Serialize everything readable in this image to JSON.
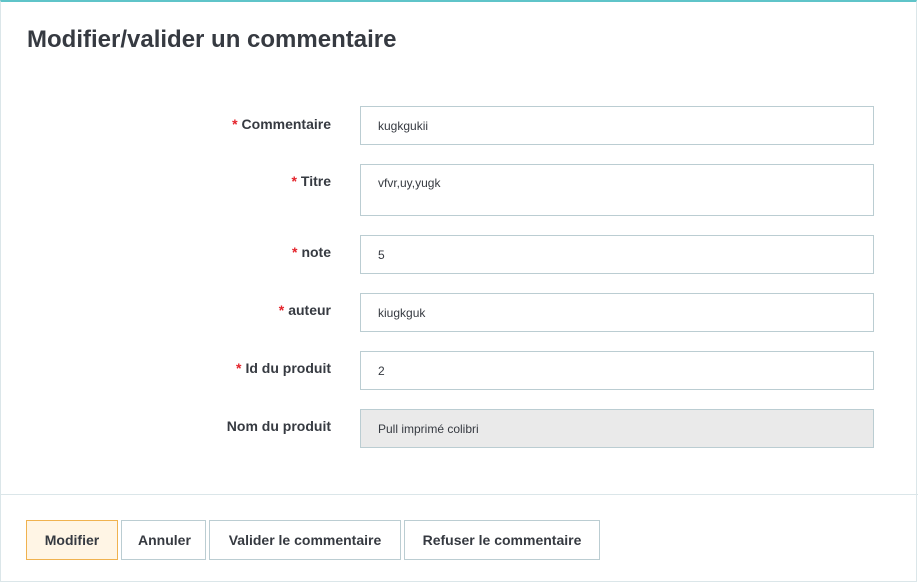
{
  "page": {
    "title": "Modifier/valider un commentaire"
  },
  "form": {
    "required_marker": "*",
    "fields": [
      {
        "label": "Commentaire",
        "value": "kugkgukii",
        "required": true
      },
      {
        "label": "Titre",
        "value": "vfvr,uy,yugk",
        "required": true
      },
      {
        "label": "note",
        "value": "5",
        "required": true
      },
      {
        "label": "auteur",
        "value": "kiugkguk",
        "required": true
      },
      {
        "label": "Id du produit",
        "value": "2",
        "required": true
      },
      {
        "label": "Nom du produit",
        "value": "Pull imprimé colibri",
        "required": false,
        "disabled": true
      }
    ]
  },
  "footer": {
    "buttons": [
      {
        "label": "Modifier",
        "primary": true
      },
      {
        "label": "Annuler"
      },
      {
        "label": "Valider le commentaire"
      },
      {
        "label": "Refuser le commentaire"
      }
    ]
  },
  "colors": {
    "accent_top_border": "#5fc4c9",
    "required_star": "#e4232b",
    "primary_button_bg": "#fff5e5",
    "primary_button_border": "#f0b24f",
    "disabled_input_bg": "#eaeaea"
  }
}
